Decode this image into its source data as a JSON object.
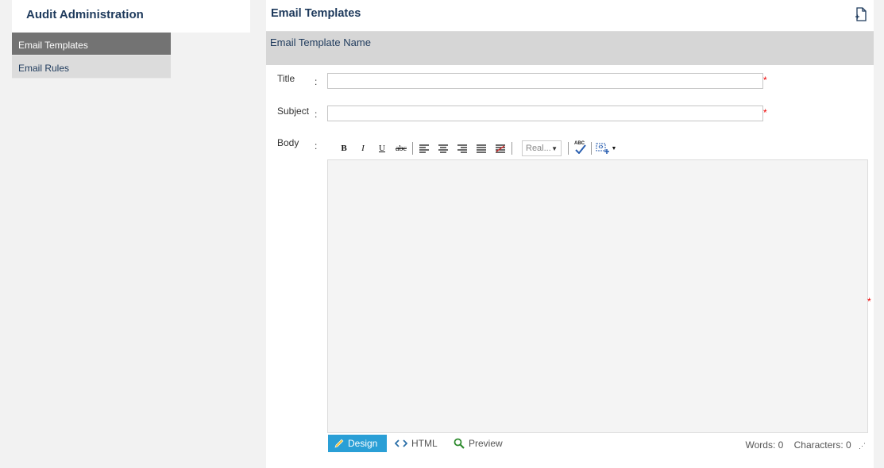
{
  "sidebar": {
    "title": "Audit Administration",
    "items": [
      {
        "label": "Email Templates",
        "active": true
      },
      {
        "label": "Email Rules",
        "active": false
      }
    ]
  },
  "header": {
    "title": "Email Templates",
    "new_icon": "new-document-icon"
  },
  "section": {
    "title": "Email Template Name"
  },
  "form": {
    "title_label": "Title",
    "subject_label": "Subject",
    "body_label": "Body",
    "colon": ":",
    "required_mark": "*",
    "title_value": "",
    "subject_value": ""
  },
  "toolbar": {
    "bold": "B",
    "italic": "I",
    "underline": "U",
    "strike": "abc",
    "font_select": "Real...",
    "spell_label": "ABC"
  },
  "modes": {
    "design": "Design",
    "html": "HTML",
    "preview": "Preview"
  },
  "status": {
    "words": "Words: 0",
    "characters": "Characters: 0"
  },
  "colors": {
    "accent": "#2a9fd6",
    "nav_active": "#737373",
    "heading": "#1e3a5c",
    "required": "#e00000"
  }
}
